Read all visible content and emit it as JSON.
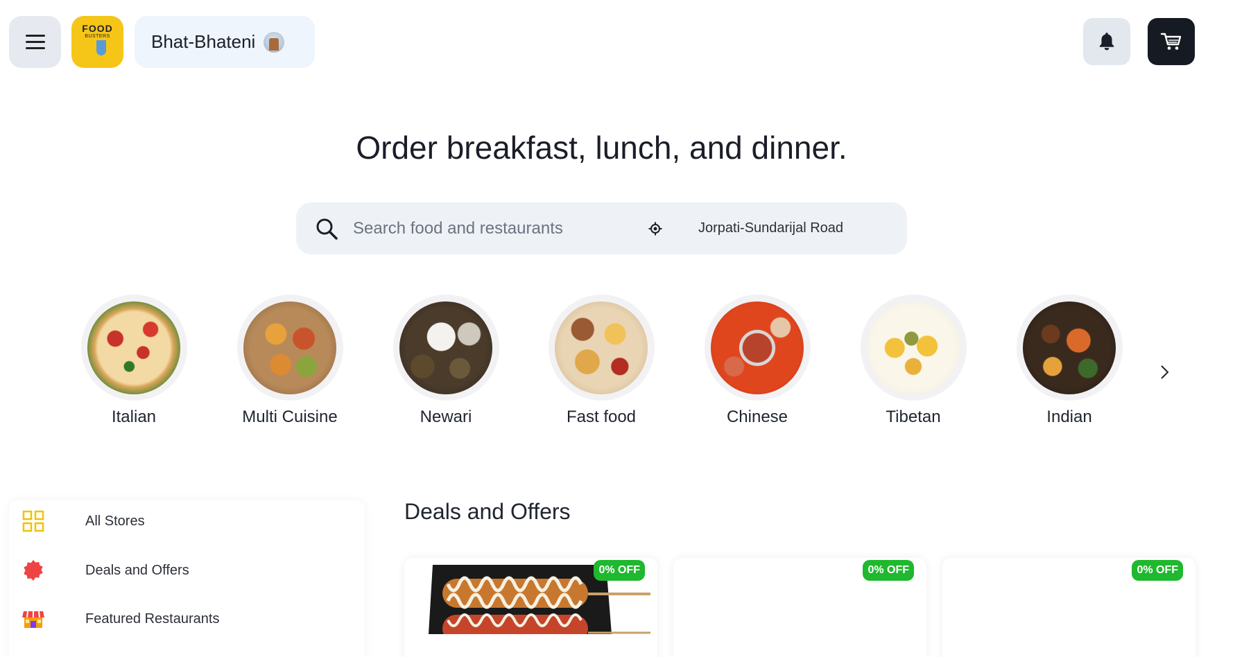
{
  "header": {
    "menu_icon": "hamburger-menu-icon",
    "logo_line1": "FOOD",
    "logo_line2": "BUSTERS",
    "store_name": "Bhat-Bhateni",
    "store_icon": "temple-icon",
    "notification_icon": "bell-icon",
    "cart_icon": "cart-icon"
  },
  "hero": {
    "headline": "Order breakfast, lunch, and dinner.",
    "search_placeholder": "Search food and restaurants",
    "location": "Jorpati-Sundarijal Road"
  },
  "categories": [
    {
      "label": "Italian",
      "image": "pizza"
    },
    {
      "label": "Multi Cuisine",
      "image": "multi-cuisine-platter"
    },
    {
      "label": "Newari",
      "image": "newari-food"
    },
    {
      "label": "Fast food",
      "image": "fast-food-platter"
    },
    {
      "label": "Chinese",
      "image": "chinese-hotpot"
    },
    {
      "label": "Tibetan",
      "image": "tibetan-dish"
    },
    {
      "label": "Indian",
      "image": "indian-thali"
    }
  ],
  "sidebar": {
    "items": [
      {
        "label": "All Stores",
        "icon": "grid-icon"
      },
      {
        "label": "Deals and Offers",
        "icon": "badge-icon"
      },
      {
        "label": "Featured Restaurants",
        "icon": "storefront-icon"
      }
    ]
  },
  "deals": {
    "title": "Deals and Offers",
    "cards": [
      {
        "badge": "0% OFF",
        "image": "corn-dog"
      },
      {
        "badge": "0% OFF",
        "image": ""
      },
      {
        "badge": "0% OFF",
        "image": ""
      }
    ]
  },
  "colors": {
    "accent_yellow": "#f5c518",
    "offer_green": "#1fb82e",
    "dark_button": "#161a22"
  }
}
